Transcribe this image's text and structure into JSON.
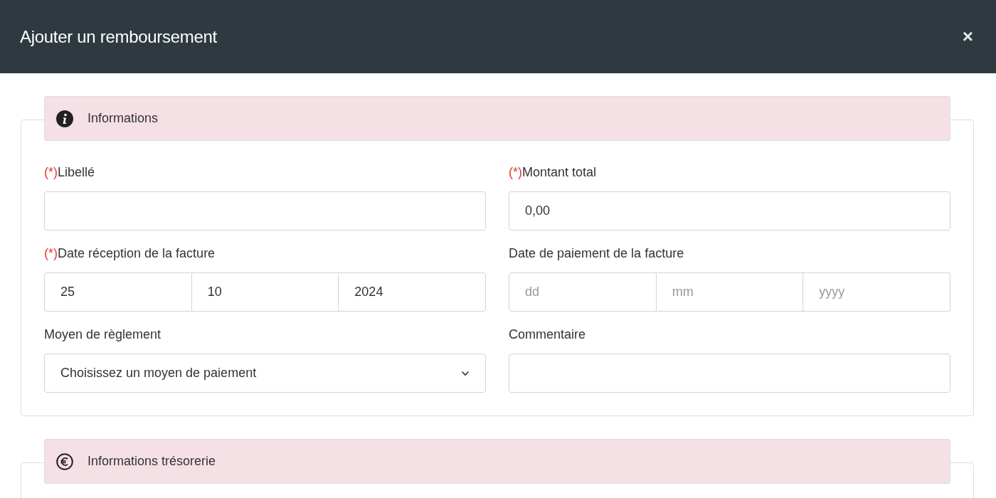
{
  "dialog": {
    "title": "Ajouter un remboursement",
    "close": "×"
  },
  "sections": [
    {
      "title": "Informations",
      "kind": "general",
      "fields": [
        {
          "kind": "text",
          "marker": "(*)",
          "label": "Libellé"
        },
        {
          "kind": "text",
          "marker": "(*)",
          "label": "Montant total",
          "value": "0,00"
        },
        {
          "kind": "date",
          "marker": "(*)",
          "label": "Date réception de la facture",
          "parts": [
            {
              "value": "25"
            },
            {
              "value": "10"
            },
            {
              "value": "2024"
            }
          ]
        },
        {
          "kind": "date",
          "label": "Date de paiement de la facture",
          "parts": [
            {
              "placeholder": "dd"
            },
            {
              "placeholder": "mm"
            },
            {
              "placeholder": "yyyy"
            }
          ]
        },
        {
          "kind": "select",
          "label": "Moyen de règlement",
          "value": "Choisissez un moyen de paiement"
        },
        {
          "kind": "text",
          "label": "Commentaire"
        }
      ]
    },
    {
      "title": "Informations trésorerie",
      "kind": "treasury"
    }
  ]
}
